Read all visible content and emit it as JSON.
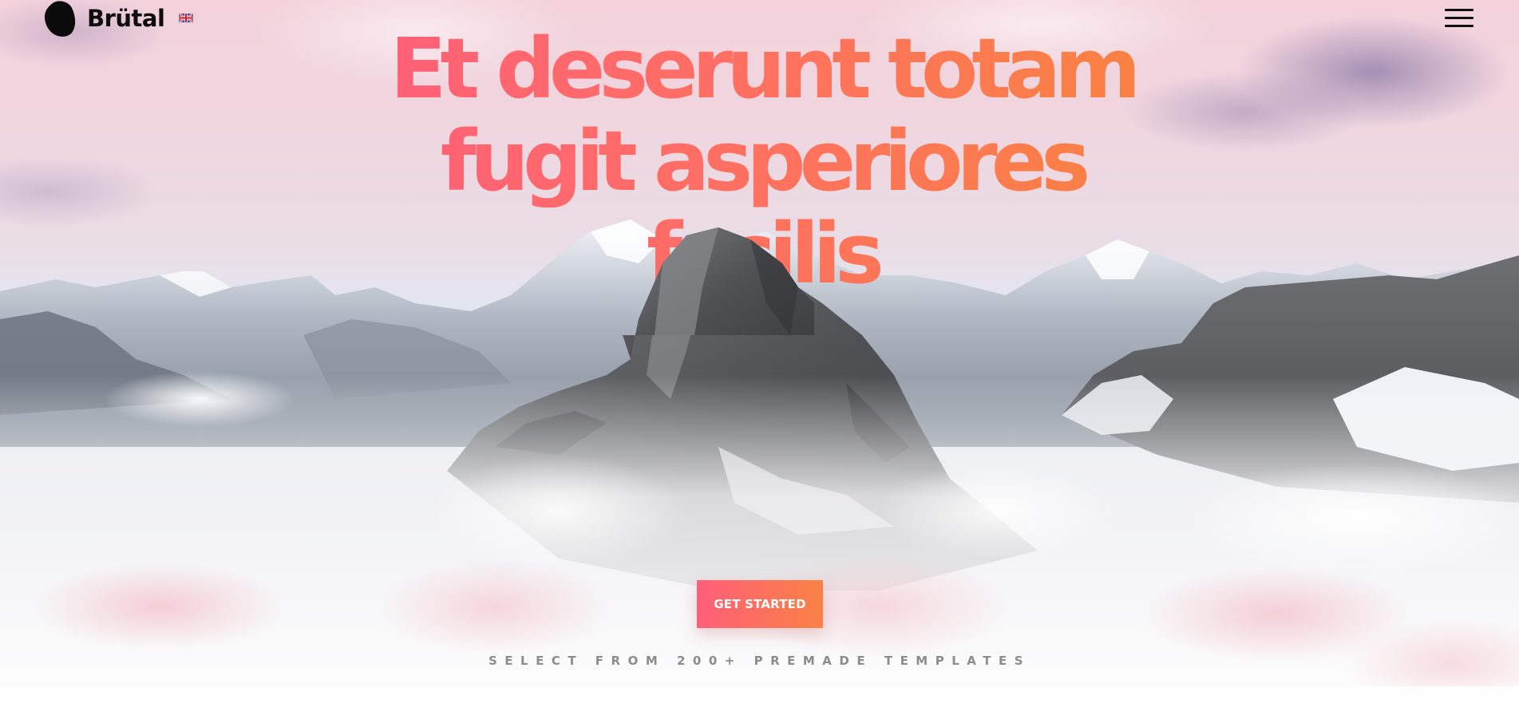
{
  "header": {
    "brand": "Brütal",
    "language_icon": "uk-flag-icon",
    "menu_icon": "hamburger-menu-icon",
    "logo_icon": "blob-logo-icon"
  },
  "hero": {
    "headline_lines": [
      "Et deserunt totam",
      "fugit asperiores",
      "facilis"
    ],
    "cta_label": "GET STARTED",
    "tagline": "SELECT FROM 200+ PREMADE TEMPLATES",
    "background": "snowy-mountain-peaks-above-clouds"
  },
  "colors": {
    "gradient_start": "#ff5e7a",
    "gradient_end": "#f98244",
    "tagline": "#8c8c8c",
    "brand_text": "#0d0d0d"
  }
}
